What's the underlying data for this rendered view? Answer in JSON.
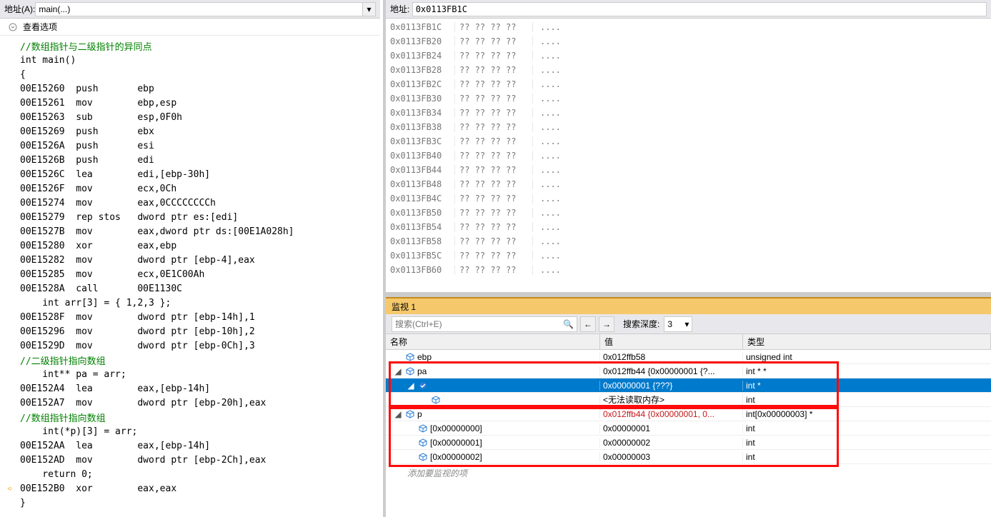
{
  "left": {
    "address_label": "地址(A):",
    "address_value": "main(...)",
    "options_label": "查看选项",
    "gutter_arrow_at": 31
  },
  "code_lines": [
    {
      "t": "comment",
      "text": "//数组指针与二级指针的异同点"
    },
    {
      "t": "plain",
      "text": "int main()"
    },
    {
      "t": "plain",
      "text": "{"
    },
    {
      "t": "asm",
      "addr": "00E15260",
      "op": "push",
      "args": "ebp"
    },
    {
      "t": "asm",
      "addr": "00E15261",
      "op": "mov",
      "args": "ebp,esp"
    },
    {
      "t": "asm",
      "addr": "00E15263",
      "op": "sub",
      "args": "esp,0F0h"
    },
    {
      "t": "asm",
      "addr": "00E15269",
      "op": "push",
      "args": "ebx"
    },
    {
      "t": "asm",
      "addr": "00E1526A",
      "op": "push",
      "args": "esi"
    },
    {
      "t": "asm",
      "addr": "00E1526B",
      "op": "push",
      "args": "edi"
    },
    {
      "t": "asm",
      "addr": "00E1526C",
      "op": "lea",
      "args": "edi,[ebp-30h]"
    },
    {
      "t": "asm",
      "addr": "00E1526F",
      "op": "mov",
      "args": "ecx,0Ch"
    },
    {
      "t": "asm",
      "addr": "00E15274",
      "op": "mov",
      "args": "eax,0CCCCCCCCh"
    },
    {
      "t": "asm",
      "addr": "00E15279",
      "op": "rep stos",
      "args": "dword ptr es:[edi]"
    },
    {
      "t": "asm",
      "addr": "00E1527B",
      "op": "mov",
      "args": "eax,dword ptr ds:[00E1A028h]"
    },
    {
      "t": "asm",
      "addr": "00E15280",
      "op": "xor",
      "args": "eax,ebp"
    },
    {
      "t": "asm",
      "addr": "00E15282",
      "op": "mov",
      "args": "dword ptr [ebp-4],eax"
    },
    {
      "t": "asm",
      "addr": "00E15285",
      "op": "mov",
      "args": "ecx,0E1C00Ah"
    },
    {
      "t": "asm",
      "addr": "00E1528A",
      "op": "call",
      "args": "00E1130C"
    },
    {
      "t": "indent",
      "text": "int arr[3] = { 1,2,3 };"
    },
    {
      "t": "asm",
      "addr": "00E1528F",
      "op": "mov",
      "args": "dword ptr [ebp-14h],1"
    },
    {
      "t": "asm",
      "addr": "00E15296",
      "op": "mov",
      "args": "dword ptr [ebp-10h],2"
    },
    {
      "t": "asm",
      "addr": "00E1529D",
      "op": "mov",
      "args": "dword ptr [ebp-0Ch],3"
    },
    {
      "t": "indent_comment",
      "text": "//二级指针指向数组"
    },
    {
      "t": "indent",
      "text": "int** pa = arr;"
    },
    {
      "t": "asm",
      "addr": "00E152A4",
      "op": "lea",
      "args": "eax,[ebp-14h]"
    },
    {
      "t": "asm",
      "addr": "00E152A7",
      "op": "mov",
      "args": "dword ptr [ebp-20h],eax"
    },
    {
      "t": "indent_comment",
      "text": "//数组指针指向数组"
    },
    {
      "t": "indent",
      "text": "int(*p)[3] = arr;"
    },
    {
      "t": "asm",
      "addr": "00E152AA",
      "op": "lea",
      "args": "eax,[ebp-14h]"
    },
    {
      "t": "asm",
      "addr": "00E152AD",
      "op": "mov",
      "args": "dword ptr [ebp-2Ch],eax"
    },
    {
      "t": "indent",
      "text": "return 0;"
    },
    {
      "t": "asm",
      "addr": "00E152B0",
      "op": "xor",
      "args": "eax,eax"
    },
    {
      "t": "plain",
      "text": "}"
    }
  ],
  "memory": {
    "address_label": "地址:",
    "address_value": "0x0113FB1C",
    "rows": [
      {
        "addr": "0x0113FB1C",
        "bytes": "?? ?? ?? ??",
        "ascii": "...."
      },
      {
        "addr": "0x0113FB20",
        "bytes": "?? ?? ?? ??",
        "ascii": "...."
      },
      {
        "addr": "0x0113FB24",
        "bytes": "?? ?? ?? ??",
        "ascii": "...."
      },
      {
        "addr": "0x0113FB28",
        "bytes": "?? ?? ?? ??",
        "ascii": "...."
      },
      {
        "addr": "0x0113FB2C",
        "bytes": "?? ?? ?? ??",
        "ascii": "...."
      },
      {
        "addr": "0x0113FB30",
        "bytes": "?? ?? ?? ??",
        "ascii": "...."
      },
      {
        "addr": "0x0113FB34",
        "bytes": "?? ?? ?? ??",
        "ascii": "...."
      },
      {
        "addr": "0x0113FB38",
        "bytes": "?? ?? ?? ??",
        "ascii": "...."
      },
      {
        "addr": "0x0113FB3C",
        "bytes": "?? ?? ?? ??",
        "ascii": "...."
      },
      {
        "addr": "0x0113FB40",
        "bytes": "?? ?? ?? ??",
        "ascii": "...."
      },
      {
        "addr": "0x0113FB44",
        "bytes": "?? ?? ?? ??",
        "ascii": "...."
      },
      {
        "addr": "0x0113FB48",
        "bytes": "?? ?? ?? ??",
        "ascii": "...."
      },
      {
        "addr": "0x0113FB4C",
        "bytes": "?? ?? ?? ??",
        "ascii": "...."
      },
      {
        "addr": "0x0113FB50",
        "bytes": "?? ?? ?? ??",
        "ascii": "...."
      },
      {
        "addr": "0x0113FB54",
        "bytes": "?? ?? ?? ??",
        "ascii": "...."
      },
      {
        "addr": "0x0113FB58",
        "bytes": "?? ?? ?? ??",
        "ascii": "...."
      },
      {
        "addr": "0x0113FB5C",
        "bytes": "?? ?? ?? ??",
        "ascii": "...."
      },
      {
        "addr": "0x0113FB60",
        "bytes": "?? ?? ?? ??",
        "ascii": "...."
      }
    ]
  },
  "watch": {
    "title": "监视 1",
    "search_placeholder": "搜索(Ctrl+E)",
    "depth_label": "搜索深度:",
    "depth_value": "3",
    "columns": {
      "name": "名称",
      "value": "值",
      "type": "类型"
    },
    "rows": [
      {
        "indent": 0,
        "expand": "",
        "icon": "cube",
        "name": "ebp",
        "value": "0x012ffb58",
        "type": "unsigned int",
        "selected": false,
        "red": false
      },
      {
        "indent": 0,
        "expand": "open",
        "icon": "cube",
        "name": "pa",
        "value": "0x012ffb44 {0x00000001 {?...",
        "type": "int * *",
        "selected": false,
        "red": false
      },
      {
        "indent": 1,
        "expand": "open",
        "icon": "check",
        "name": "",
        "value": "0x00000001 {???}",
        "type": "int *",
        "selected": true,
        "red": false
      },
      {
        "indent": 2,
        "expand": "",
        "icon": "cube",
        "name": "",
        "value": "<无法读取内存>",
        "type": "int",
        "selected": false,
        "red": false
      },
      {
        "indent": 0,
        "expand": "open",
        "icon": "cube",
        "name": "p",
        "value": "0x012ffb44 {0x00000001, 0...",
        "type": "int[0x00000003] *",
        "selected": false,
        "red": true
      },
      {
        "indent": 1,
        "expand": "",
        "icon": "cube",
        "name": "[0x00000000]",
        "value": "0x00000001",
        "type": "int",
        "selected": false,
        "red": false
      },
      {
        "indent": 1,
        "expand": "",
        "icon": "cube",
        "name": "[0x00000001]",
        "value": "0x00000002",
        "type": "int",
        "selected": false,
        "red": false
      },
      {
        "indent": 1,
        "expand": "",
        "icon": "cube",
        "name": "[0x00000002]",
        "value": "0x00000003",
        "type": "int",
        "selected": false,
        "red": false
      }
    ],
    "add_text": "添加要监视的项"
  }
}
